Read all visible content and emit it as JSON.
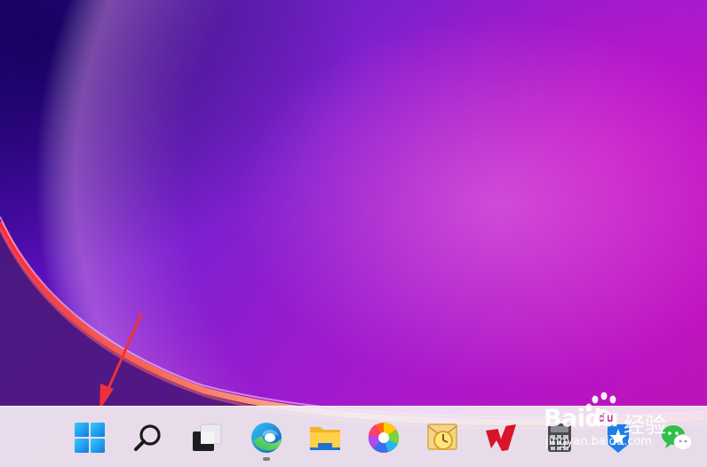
{
  "desktop": {
    "wallpaper": "windows-11-bloom",
    "accent_colors": [
      "#2a0a8a",
      "#9a08c6",
      "#c000a0",
      "#ff5a3c"
    ]
  },
  "taskbar": {
    "items": [
      {
        "name": "start-button",
        "icon": "windows-logo-icon",
        "running": false
      },
      {
        "name": "search-button",
        "icon": "search-icon",
        "running": false
      },
      {
        "name": "task-view-button",
        "icon": "task-view-icon",
        "running": false
      },
      {
        "name": "edge-button",
        "icon": "edge-icon",
        "running": true
      },
      {
        "name": "file-explorer-button",
        "icon": "folder-icon",
        "running": false
      },
      {
        "name": "photos-app-button",
        "icon": "pinwheel-icon",
        "running": false
      },
      {
        "name": "outlook-button",
        "icon": "outlook-clock-icon",
        "running": false
      },
      {
        "name": "red-app-button",
        "icon": "red-wing-icon",
        "running": false
      },
      {
        "name": "calculator-button",
        "icon": "calculator-icon",
        "running": false
      },
      {
        "name": "blue-app-button",
        "icon": "blue-star-icon",
        "running": false
      },
      {
        "name": "wechat-button",
        "icon": "wechat-icon",
        "running": false
      }
    ]
  },
  "watermark": {
    "brand": "Baidu",
    "brand_cn": "经验",
    "url": "jingyan.baidu.com"
  },
  "annotation": {
    "arrow_color": "#f0303a",
    "points_to": "start-button"
  }
}
